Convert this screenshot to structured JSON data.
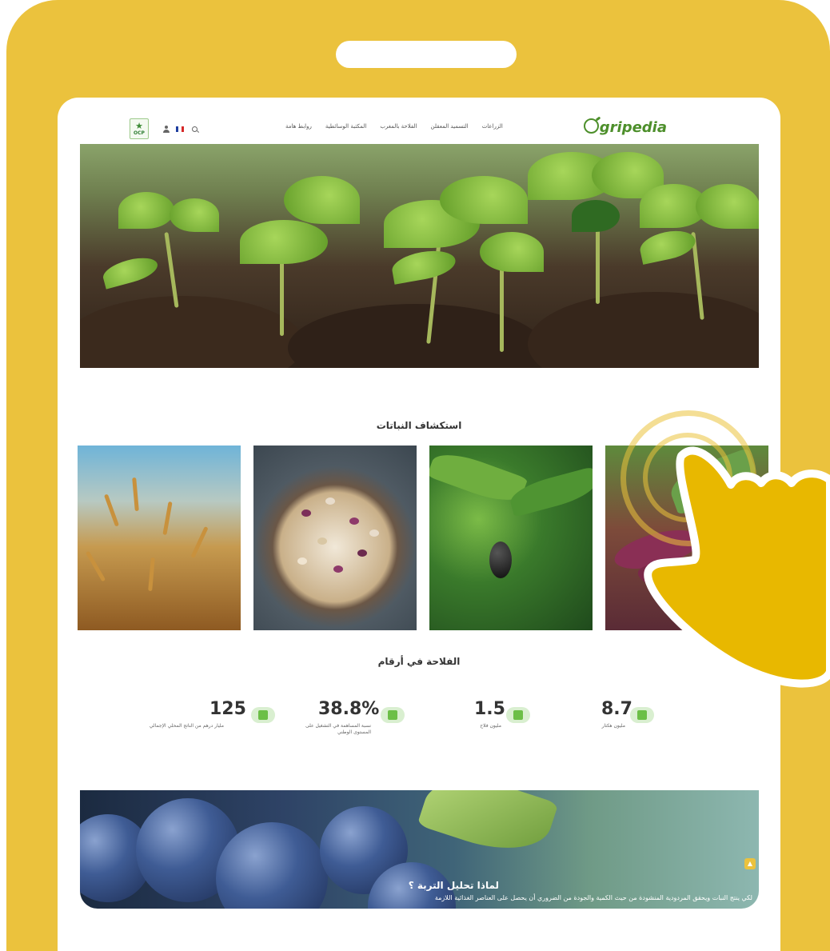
{
  "site": {
    "logo": "Ogripedia",
    "nav": [
      "الزراعات",
      "التسميد المعقلن",
      "الفلاحة بالمغرب",
      "المكتبة الوسائطية",
      "روابط هامة"
    ],
    "partner_logo": "OCP"
  },
  "sections": {
    "plants_title": "استكشاف النباتات",
    "numbers_title": "الفلاحة في أرقام"
  },
  "plants": [
    {
      "name": "wheat"
    },
    {
      "name": "beans"
    },
    {
      "name": "olive"
    },
    {
      "name": "sweet-potato"
    }
  ],
  "stats": [
    {
      "value": "8.7",
      "label": "مليون هكتار"
    },
    {
      "value": "1.5",
      "label": "مليون فلاح"
    },
    {
      "value": "38.8%",
      "label": "نسبة المساهمة في التشغيل على المستوى الوطني"
    },
    {
      "value": "125",
      "label": "مليار درهم من الناتج المحلي الإجمالي"
    }
  ],
  "banner": {
    "title": "لماذا تحليل التربة ؟",
    "text": "لكي ينتج النبات ويحقق المردودية المنشودة من حيث الكمية والجودة من الضروري أن يحصل على العناصر الغذائية اللازمة"
  },
  "colors": {
    "frame": "#ebc23d",
    "brand_green": "#4d8f2b"
  }
}
